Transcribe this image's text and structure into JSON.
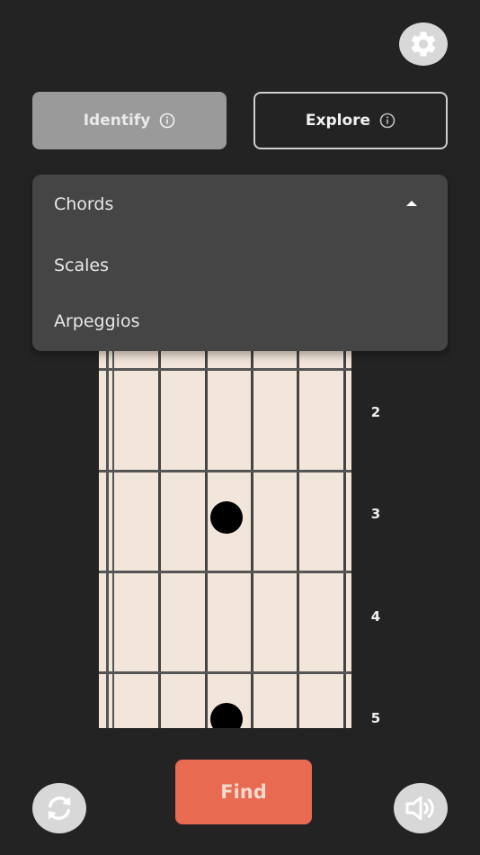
{
  "modes": {
    "identify_label": "Identify",
    "explore_label": "Explore",
    "selected": "Identify"
  },
  "dropdown": {
    "selected": "Chords",
    "options": [
      "Chords",
      "Scales",
      "Arpeggios"
    ],
    "expanded": true
  },
  "fretboard": {
    "fret_numbers": [
      "2",
      "3",
      "4",
      "5"
    ],
    "markers": [
      {
        "fret": 3,
        "string": 3
      },
      {
        "fret": 5,
        "string": 3
      }
    ]
  },
  "actions": {
    "find_label": "Find"
  },
  "icons": {
    "settings": "gear-icon",
    "info": "info-icon",
    "caret": "caret-up-icon",
    "reset": "refresh-icon",
    "sound": "speaker-icon"
  },
  "colors": {
    "background": "#232323",
    "accent": "#e86a50",
    "fretboard": "#f2e5da",
    "dropdown": "#454545"
  }
}
